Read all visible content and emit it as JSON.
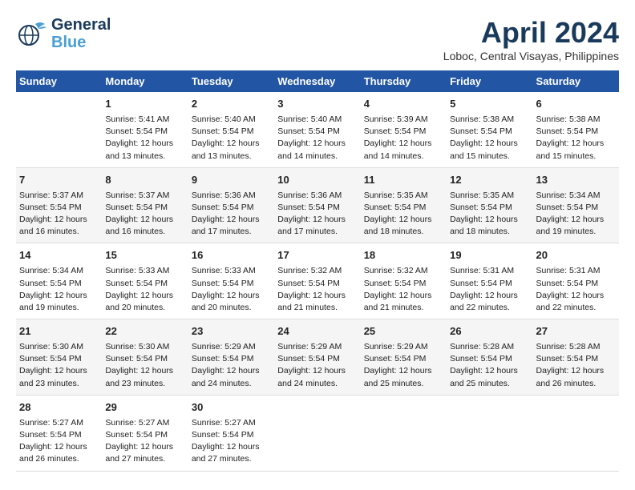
{
  "header": {
    "logo_line1": "General",
    "logo_line2": "Blue",
    "month_title": "April 2024",
    "location": "Loboc, Central Visayas, Philippines"
  },
  "calendar": {
    "days_of_week": [
      "Sunday",
      "Monday",
      "Tuesday",
      "Wednesday",
      "Thursday",
      "Friday",
      "Saturday"
    ],
    "rows": [
      [
        {
          "day": "",
          "info": ""
        },
        {
          "day": "1",
          "info": "Sunrise: 5:41 AM\nSunset: 5:54 PM\nDaylight: 12 hours\nand 13 minutes."
        },
        {
          "day": "2",
          "info": "Sunrise: 5:40 AM\nSunset: 5:54 PM\nDaylight: 12 hours\nand 13 minutes."
        },
        {
          "day": "3",
          "info": "Sunrise: 5:40 AM\nSunset: 5:54 PM\nDaylight: 12 hours\nand 14 minutes."
        },
        {
          "day": "4",
          "info": "Sunrise: 5:39 AM\nSunset: 5:54 PM\nDaylight: 12 hours\nand 14 minutes."
        },
        {
          "day": "5",
          "info": "Sunrise: 5:38 AM\nSunset: 5:54 PM\nDaylight: 12 hours\nand 15 minutes."
        },
        {
          "day": "6",
          "info": "Sunrise: 5:38 AM\nSunset: 5:54 PM\nDaylight: 12 hours\nand 15 minutes."
        }
      ],
      [
        {
          "day": "7",
          "info": "Sunrise: 5:37 AM\nSunset: 5:54 PM\nDaylight: 12 hours\nand 16 minutes."
        },
        {
          "day": "8",
          "info": "Sunrise: 5:37 AM\nSunset: 5:54 PM\nDaylight: 12 hours\nand 16 minutes."
        },
        {
          "day": "9",
          "info": "Sunrise: 5:36 AM\nSunset: 5:54 PM\nDaylight: 12 hours\nand 17 minutes."
        },
        {
          "day": "10",
          "info": "Sunrise: 5:36 AM\nSunset: 5:54 PM\nDaylight: 12 hours\nand 17 minutes."
        },
        {
          "day": "11",
          "info": "Sunrise: 5:35 AM\nSunset: 5:54 PM\nDaylight: 12 hours\nand 18 minutes."
        },
        {
          "day": "12",
          "info": "Sunrise: 5:35 AM\nSunset: 5:54 PM\nDaylight: 12 hours\nand 18 minutes."
        },
        {
          "day": "13",
          "info": "Sunrise: 5:34 AM\nSunset: 5:54 PM\nDaylight: 12 hours\nand 19 minutes."
        }
      ],
      [
        {
          "day": "14",
          "info": "Sunrise: 5:34 AM\nSunset: 5:54 PM\nDaylight: 12 hours\nand 19 minutes."
        },
        {
          "day": "15",
          "info": "Sunrise: 5:33 AM\nSunset: 5:54 PM\nDaylight: 12 hours\nand 20 minutes."
        },
        {
          "day": "16",
          "info": "Sunrise: 5:33 AM\nSunset: 5:54 PM\nDaylight: 12 hours\nand 20 minutes."
        },
        {
          "day": "17",
          "info": "Sunrise: 5:32 AM\nSunset: 5:54 PM\nDaylight: 12 hours\nand 21 minutes."
        },
        {
          "day": "18",
          "info": "Sunrise: 5:32 AM\nSunset: 5:54 PM\nDaylight: 12 hours\nand 21 minutes."
        },
        {
          "day": "19",
          "info": "Sunrise: 5:31 AM\nSunset: 5:54 PM\nDaylight: 12 hours\nand 22 minutes."
        },
        {
          "day": "20",
          "info": "Sunrise: 5:31 AM\nSunset: 5:54 PM\nDaylight: 12 hours\nand 22 minutes."
        }
      ],
      [
        {
          "day": "21",
          "info": "Sunrise: 5:30 AM\nSunset: 5:54 PM\nDaylight: 12 hours\nand 23 minutes."
        },
        {
          "day": "22",
          "info": "Sunrise: 5:30 AM\nSunset: 5:54 PM\nDaylight: 12 hours\nand 23 minutes."
        },
        {
          "day": "23",
          "info": "Sunrise: 5:29 AM\nSunset: 5:54 PM\nDaylight: 12 hours\nand 24 minutes."
        },
        {
          "day": "24",
          "info": "Sunrise: 5:29 AM\nSunset: 5:54 PM\nDaylight: 12 hours\nand 24 minutes."
        },
        {
          "day": "25",
          "info": "Sunrise: 5:29 AM\nSunset: 5:54 PM\nDaylight: 12 hours\nand 25 minutes."
        },
        {
          "day": "26",
          "info": "Sunrise: 5:28 AM\nSunset: 5:54 PM\nDaylight: 12 hours\nand 25 minutes."
        },
        {
          "day": "27",
          "info": "Sunrise: 5:28 AM\nSunset: 5:54 PM\nDaylight: 12 hours\nand 26 minutes."
        }
      ],
      [
        {
          "day": "28",
          "info": "Sunrise: 5:27 AM\nSunset: 5:54 PM\nDaylight: 12 hours\nand 26 minutes."
        },
        {
          "day": "29",
          "info": "Sunrise: 5:27 AM\nSunset: 5:54 PM\nDaylight: 12 hours\nand 27 minutes."
        },
        {
          "day": "30",
          "info": "Sunrise: 5:27 AM\nSunset: 5:54 PM\nDaylight: 12 hours\nand 27 minutes."
        },
        {
          "day": "",
          "info": ""
        },
        {
          "day": "",
          "info": ""
        },
        {
          "day": "",
          "info": ""
        },
        {
          "day": "",
          "info": ""
        }
      ]
    ]
  }
}
